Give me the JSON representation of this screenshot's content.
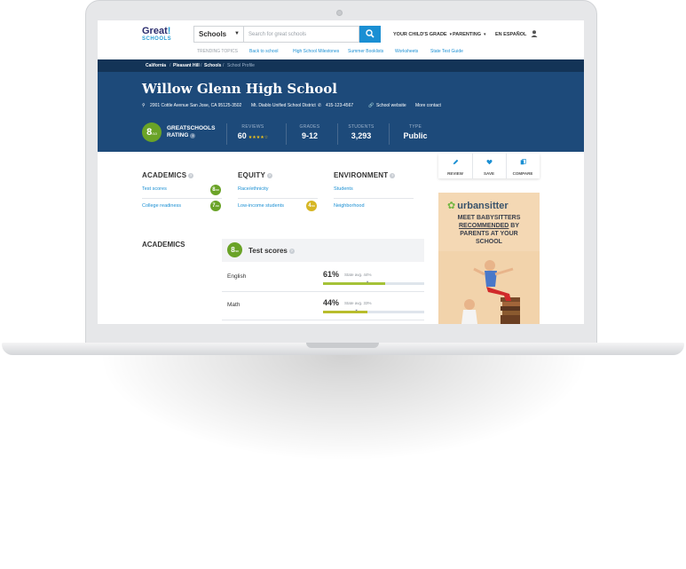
{
  "header": {
    "logo_top": "Great",
    "logo_bang": "!",
    "logo_bottom": "SCHOOLS",
    "search_select": "Schools",
    "search_placeholder": "Search for great schools",
    "nav": [
      "YOUR CHILD'S GRADE",
      "PARENTING",
      "EN ESPAÑOL"
    ],
    "trending_label": "TRENDING TOPICS",
    "trending": [
      "Back to school",
      "High School Milestones",
      "Summer Booklists",
      "Worksheets",
      "State Test Guide"
    ]
  },
  "breadcrumbs": [
    "California",
    "Pleasant Hill",
    "Schools",
    "School Profile"
  ],
  "school": {
    "name": "Willow Glenn High School",
    "address": "2001 Cottle Avenue San Jose, CA 95125-3502",
    "district": "Mt. Diablo Unified School District",
    "phone": "415-123-4567",
    "website": "School website",
    "more_contact": "More contact",
    "rating": "8",
    "rating_suffix": "/10",
    "rating_label_1": "GREATSCHOOLS",
    "rating_label_2": "RATING",
    "stats": [
      {
        "label": "REVIEWS",
        "value": "60"
      },
      {
        "label": "GRADES",
        "value": "9-12"
      },
      {
        "label": "STUDENTS",
        "value": "3,293"
      },
      {
        "label": "TYPE",
        "value": "Public"
      }
    ],
    "review_stars": 4
  },
  "actions": [
    "REVIEW",
    "SAVE",
    "COMPARE"
  ],
  "categories": {
    "academics": {
      "title": "ACADEMICS",
      "items": [
        {
          "label": "Test scores",
          "rating": "8"
        },
        {
          "label": "College readiness",
          "rating": "7"
        }
      ]
    },
    "equity": {
      "title": "EQUITY",
      "items": [
        {
          "label": "Race/ethnicity"
        },
        {
          "label": "Low-income students",
          "rating": "4"
        }
      ]
    },
    "environment": {
      "title": "ENVIRONMENT",
      "items": [
        {
          "label": "Students"
        },
        {
          "label": "Neighborhood"
        }
      ]
    }
  },
  "academics_section": {
    "heading": "ACADEMICS",
    "panel_rating": "8",
    "panel_title": "Test scores",
    "rows": [
      {
        "subject": "English",
        "pct": "61%",
        "value": 61,
        "state": "State avg. 44%",
        "state_value": 44
      },
      {
        "subject": "Math",
        "pct": "44%",
        "value": 44,
        "state": "State avg. 33%",
        "state_value": 33
      }
    ]
  },
  "ad": {
    "brand": "urbansitter",
    "line1": "MEET BABYSITTERS",
    "line2": "RECOMMENDED",
    "line2b": " BY",
    "line3": "PARENTS AT YOUR",
    "line4": "SCHOOL"
  },
  "colors": {
    "navy": "#133457",
    "hero": "#1d4a7a",
    "blue": "#1a8fd3",
    "green": "#6aa327",
    "yellow": "#d6b624"
  }
}
